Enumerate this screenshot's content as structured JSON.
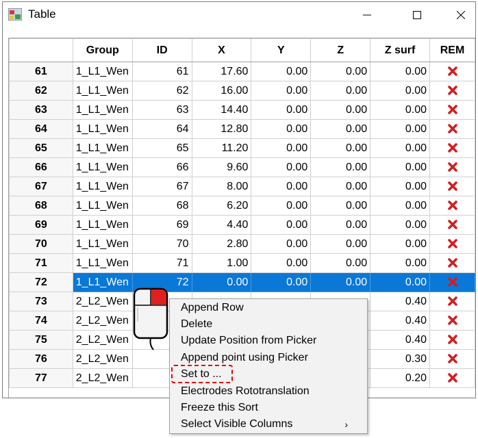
{
  "window": {
    "title": "Table",
    "controls": {
      "minimize": "minimize",
      "maximize": "maximize",
      "close": "close"
    }
  },
  "table": {
    "columns": [
      "",
      "Group",
      "ID",
      "X",
      "Y",
      "Z",
      "Z surf",
      "REM"
    ],
    "rows": [
      {
        "num": "61",
        "group": "1_L1_Wen",
        "id": "61",
        "x": "17.60",
        "y": "0.00",
        "z": "0.00",
        "zsurf": "0.00"
      },
      {
        "num": "62",
        "group": "1_L1_Wen",
        "id": "62",
        "x": "16.00",
        "y": "0.00",
        "z": "0.00",
        "zsurf": "0.00"
      },
      {
        "num": "63",
        "group": "1_L1_Wen",
        "id": "63",
        "x": "14.40",
        "y": "0.00",
        "z": "0.00",
        "zsurf": "0.00"
      },
      {
        "num": "64",
        "group": "1_L1_Wen",
        "id": "64",
        "x": "12.80",
        "y": "0.00",
        "z": "0.00",
        "zsurf": "0.00"
      },
      {
        "num": "65",
        "group": "1_L1_Wen",
        "id": "65",
        "x": "11.20",
        "y": "0.00",
        "z": "0.00",
        "zsurf": "0.00"
      },
      {
        "num": "66",
        "group": "1_L1_Wen",
        "id": "66",
        "x": "9.60",
        "y": "0.00",
        "z": "0.00",
        "zsurf": "0.00"
      },
      {
        "num": "67",
        "group": "1_L1_Wen",
        "id": "67",
        "x": "8.00",
        "y": "0.00",
        "z": "0.00",
        "zsurf": "0.00"
      },
      {
        "num": "68",
        "group": "1_L1_Wen",
        "id": "68",
        "x": "6.20",
        "y": "0.00",
        "z": "0.00",
        "zsurf": "0.00"
      },
      {
        "num": "69",
        "group": "1_L1_Wen",
        "id": "69",
        "x": "4.40",
        "y": "0.00",
        "z": "0.00",
        "zsurf": "0.00"
      },
      {
        "num": "70",
        "group": "1_L1_Wen",
        "id": "70",
        "x": "2.80",
        "y": "0.00",
        "z": "0.00",
        "zsurf": "0.00"
      },
      {
        "num": "71",
        "group": "1_L1_Wen",
        "id": "71",
        "x": "1.00",
        "y": "0.00",
        "z": "0.00",
        "zsurf": "0.00"
      },
      {
        "num": "72",
        "group": "1_L1_Wen",
        "id": "72",
        "x": "0.00",
        "y": "0.00",
        "z": "0.00",
        "zsurf": "0.00",
        "selected": true
      },
      {
        "num": "73",
        "group": "2_L2_Wen",
        "id": "",
        "x": "",
        "y": "",
        "z": "",
        "zsurf": "0.40"
      },
      {
        "num": "74",
        "group": "2_L2_Wen",
        "id": "",
        "x": "",
        "y": "",
        "z": "",
        "zsurf": "0.40"
      },
      {
        "num": "75",
        "group": "2_L2_Wen",
        "id": "",
        "x": "",
        "y": "",
        "z": "",
        "zsurf": "0.40"
      },
      {
        "num": "76",
        "group": "2_L2_Wen",
        "id": "",
        "x": "",
        "y": "",
        "z": "",
        "zsurf": "0.30"
      },
      {
        "num": "77",
        "group": "2_L2_Wen",
        "id": "",
        "x": "",
        "y": "",
        "z": "",
        "zsurf": "0.20"
      }
    ],
    "remove_icon": "red-x-icon",
    "selection_color": "#0a78d7"
  },
  "context_menu": {
    "items": [
      "Append Row",
      "Delete",
      "Update Position from Picker",
      "Append point using Picker",
      "Set to ...",
      "Electrodes Rototranslation",
      "Freeze this Sort",
      "Select Visible Columns"
    ],
    "submenu_arrow": "›",
    "highlighted_item": "Set to ...",
    "highlight_color": "#e00000"
  }
}
